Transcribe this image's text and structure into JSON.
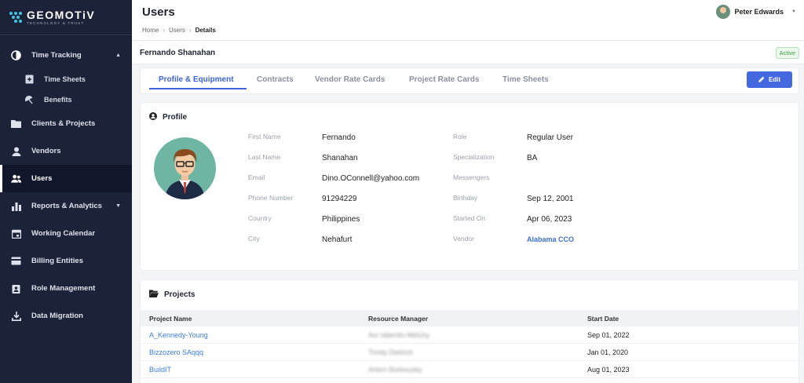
{
  "brand": {
    "name": "GEOMOTiV",
    "tagline": "TECHNOLOGY & TRUST",
    "accent": "#3fc6e3"
  },
  "sidebar": {
    "items": [
      {
        "label": "Time Tracking",
        "icon": "clock-icon",
        "expanded": true
      },
      {
        "label": "Time Sheets",
        "icon": "timesheet-icon",
        "sub": true
      },
      {
        "label": "Benefits",
        "icon": "beach-umbrella-icon",
        "sub": true
      },
      {
        "label": "Clients & Projects",
        "icon": "folder-icon"
      },
      {
        "label": "Vendors",
        "icon": "person-icon"
      },
      {
        "label": "Users",
        "icon": "users-icon",
        "active": true
      },
      {
        "label": "Reports & Analytics",
        "icon": "bar-chart-icon",
        "caret": true
      },
      {
        "label": "Working Calendar",
        "icon": "calendar-icon"
      },
      {
        "label": "Billing Entities",
        "icon": "billing-icon"
      },
      {
        "label": "Role Management",
        "icon": "id-badge-icon"
      },
      {
        "label": "Data Migration",
        "icon": "download-icon"
      }
    ]
  },
  "header": {
    "title": "Users",
    "breadcrumb": [
      "Home",
      "Users",
      "Details"
    ],
    "user_name": "Peter Edwards"
  },
  "person": {
    "name": "Fernando Shanahan",
    "status": "Active"
  },
  "tabs": {
    "items": [
      "Profile & Equipment",
      "Contracts",
      "Vendor Rate Cards",
      "Project Rate Cards",
      "Time Sheets"
    ],
    "active": "Profile & Equipment",
    "edit_label": "Edit"
  },
  "profile": {
    "title": "Profile",
    "left_fields": [
      {
        "label": "First Name",
        "value": "Fernando"
      },
      {
        "label": "Last Name",
        "value": "Shanahan"
      },
      {
        "label": "Email",
        "value": "Dino.OConnell@yahoo.com"
      },
      {
        "label": "Phone Number",
        "value": "91294229"
      },
      {
        "label": "Country",
        "value": "Philippines"
      },
      {
        "label": "City",
        "value": "Nehafurt"
      }
    ],
    "right_fields": [
      {
        "label": "Role",
        "value": "Regular User"
      },
      {
        "label": "Specialization",
        "value": "BA"
      },
      {
        "label": "Messengers",
        "value": ""
      },
      {
        "label": "Birthday",
        "value": "Sep 12, 2001"
      },
      {
        "label": "Started On",
        "value": "Apr 06, 2023"
      },
      {
        "label": "Vendor",
        "value": "Alabama CCO"
      }
    ]
  },
  "projects": {
    "title": "Projects",
    "columns": [
      "Project Name",
      "Resource Manager",
      "Start Date"
    ],
    "rows": [
      {
        "name": "A_Kennedy-Young",
        "manager": "Avi Valentin-Melchy",
        "start": "Sep 01, 2022"
      },
      {
        "name": "Bizzozero SAqqq",
        "manager": "Trinity Dietrich",
        "start": "Jan 01, 2020"
      },
      {
        "name": "BuildIT",
        "manager": "Artem Borkousky",
        "start": "Aug 01, 2023"
      }
    ]
  },
  "colors": {
    "sidebar": "#1c2237",
    "primary": "#4468e0",
    "link": "#3a7dd8",
    "active_badge": "#3ea14a"
  }
}
